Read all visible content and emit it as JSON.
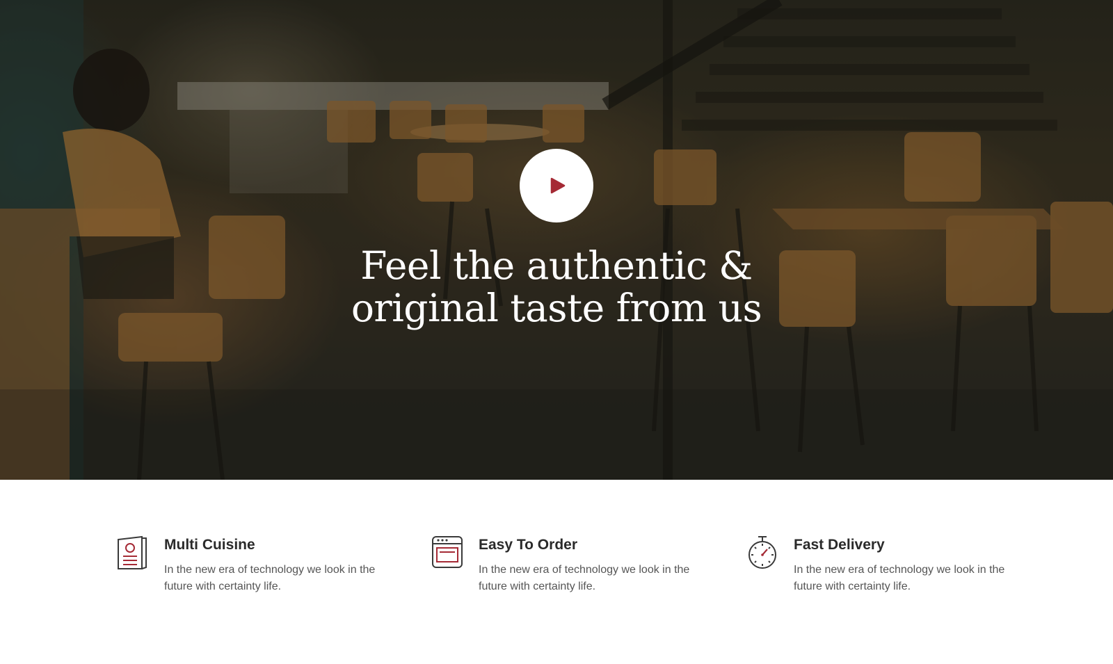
{
  "hero": {
    "title_line1": "Feel the authentic &",
    "title_line2": "original taste from us",
    "play_button_label": "Play video",
    "accent_color": "#a52a35"
  },
  "features": [
    {
      "icon": "menu-card-icon",
      "title": "Multi Cuisine",
      "description": "In the new era of technology we look in the future with certainty life."
    },
    {
      "icon": "oven-icon",
      "title": "Easy To Order",
      "description": "In the new era of technology we look in the future with certainty life."
    },
    {
      "icon": "stopwatch-icon",
      "title": "Fast Delivery",
      "description": "In the new era of technology we look in the future with certainty life."
    }
  ]
}
